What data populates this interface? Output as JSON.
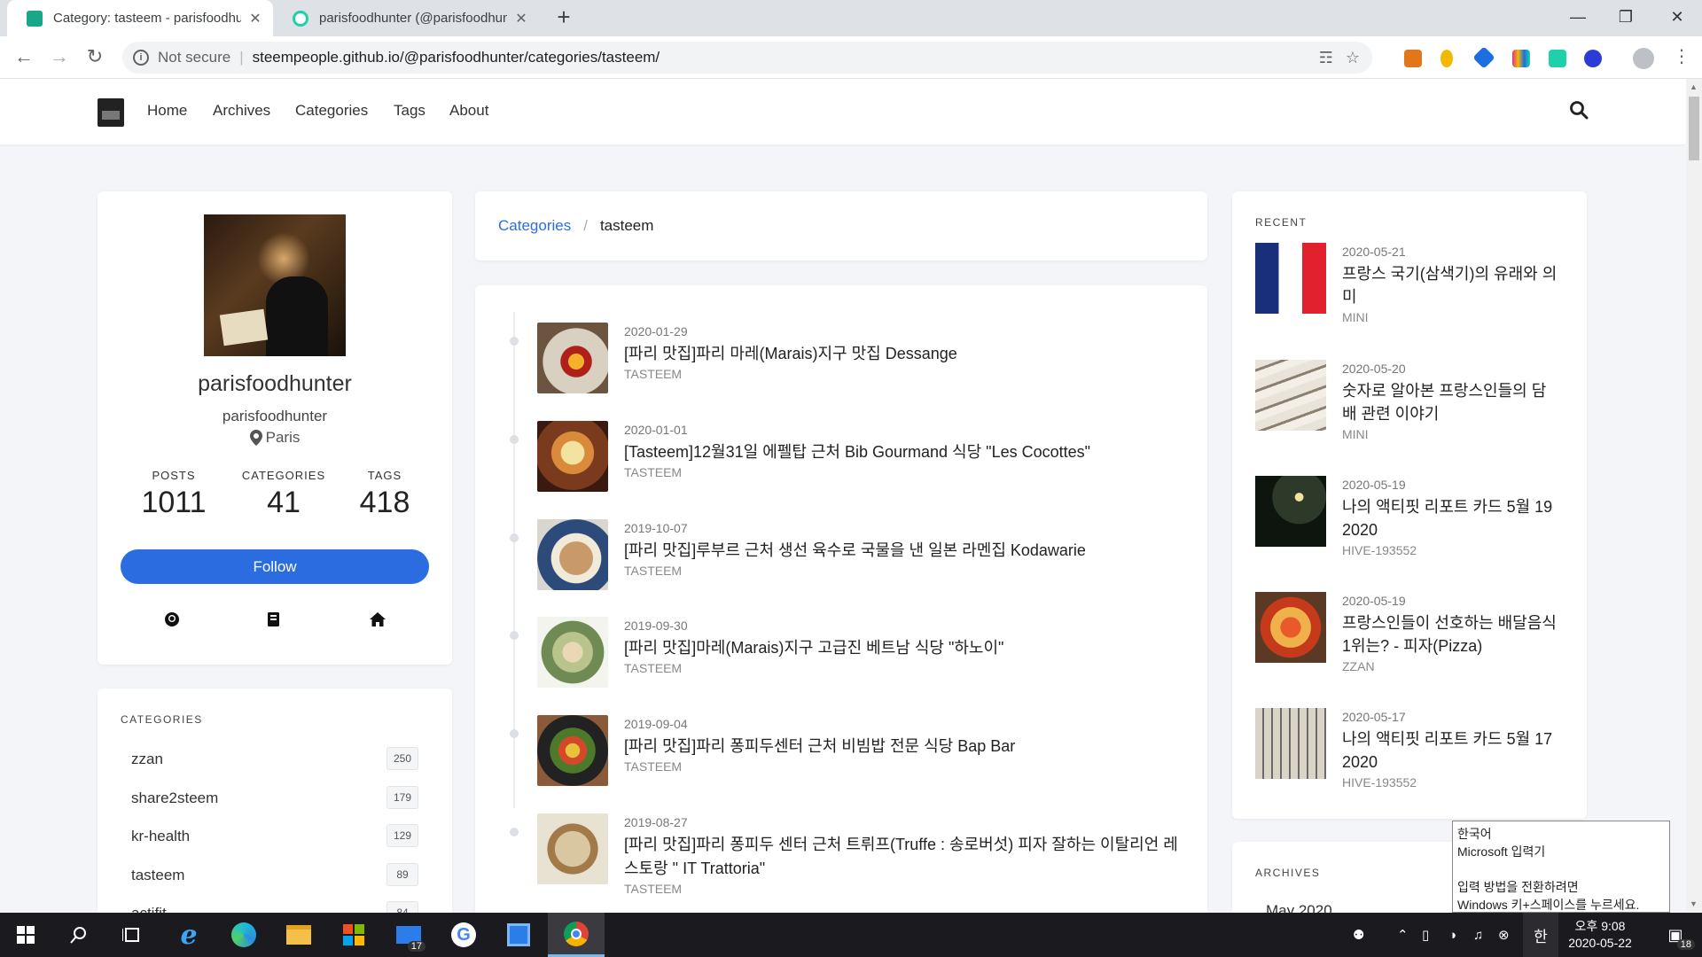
{
  "browser": {
    "tabs": [
      {
        "title": "Category: tasteem - parisfoodhunter",
        "close": "✕"
      },
      {
        "title": "parisfoodhunter (@parisfoodhunter)",
        "close": "✕"
      }
    ],
    "new_tab": "+",
    "window": {
      "minimize": "—",
      "maximize": "❐",
      "close": "✕"
    },
    "address": {
      "security": "Not secure",
      "separator": "|",
      "url": "steempeople.github.io/@parisfoodhunter/categories/tasteem/"
    },
    "icons": [
      "back-icon",
      "forward-icon",
      "reload-icon",
      "translate-icon",
      "star-icon",
      "profile-icon",
      "menu-icon"
    ],
    "extension_colors": [
      "#e2761b",
      "#f5b800",
      "#1d6fe0",
      "#e0348a",
      "#1fd1a8",
      "#2a3bd7"
    ]
  },
  "site": {
    "nav": [
      "Home",
      "Archives",
      "Categories",
      "Tags",
      "About"
    ]
  },
  "profile": {
    "name": "parisfoodhunter",
    "username": "parisfoodhunter",
    "location": "Paris",
    "stats": [
      {
        "label": "POSTS",
        "value": "1011"
      },
      {
        "label": "CATEGORIES",
        "value": "41"
      },
      {
        "label": "TAGS",
        "value": "418"
      }
    ],
    "follow_label": "Follow",
    "social_icons": [
      "github-icon",
      "book-icon",
      "home-icon"
    ]
  },
  "categories_card": {
    "heading": "CATEGORIES",
    "items": [
      {
        "name": "zzan",
        "count": "250"
      },
      {
        "name": "share2steem",
        "count": "179"
      },
      {
        "name": "kr-health",
        "count": "129"
      },
      {
        "name": "tasteem",
        "count": "89"
      },
      {
        "name": "actifit",
        "count": "84"
      }
    ]
  },
  "breadcrumb": {
    "root": "Categories",
    "sep": "/",
    "current": "tasteem"
  },
  "posts": [
    {
      "date": "2020-01-29",
      "title": "[파리 맛집]파리 마레(Marais)지구 맛집 Dessange",
      "category": "TASTEEM"
    },
    {
      "date": "2020-01-01",
      "title": "[Tasteem]12월31일 에펠탑 근처 Bib Gourmand 식당 \"Les Cocottes\"",
      "category": "TASTEEM"
    },
    {
      "date": "2019-10-07",
      "title": "[파리 맛집]루부르 근처 생선 육수로 국물을 낸 일본 라멘집 Kodawarie",
      "category": "TASTEEM"
    },
    {
      "date": "2019-09-30",
      "title": "[파리 맛집]마레(Marais)지구 고급진 베트남 식당 \"하노이\"",
      "category": "TASTEEM"
    },
    {
      "date": "2019-09-04",
      "title": "[파리 맛집]파리 퐁피두센터 근처 비빔밥 전문 식당 Bap Bar",
      "category": "TASTEEM"
    },
    {
      "date": "2019-08-27",
      "title": "[파리 맛집]파리 퐁피두 센터 근처 트뤼프(Truffe : 송로버섯) 피자 잘하는 이탈리언 레스토랑 \" IT Trattoria\"",
      "category": "TASTEEM"
    }
  ],
  "recent": {
    "heading": "RECENT",
    "items": [
      {
        "date": "2020-05-21",
        "title": "프랑스 국기(삼색기)의 유래와 의미",
        "category": "MINI"
      },
      {
        "date": "2020-05-20",
        "title": "숫자로 알아본 프랑스인들의 담배 관련 이야기",
        "category": "MINI"
      },
      {
        "date": "2020-05-19",
        "title": "나의 액티핏 리포트 카드 5월 19 2020",
        "category": "HIVE-193552"
      },
      {
        "date": "2020-05-19",
        "title": "프랑스인들이 선호하는 배달음식 1위는? - 피자(Pizza)",
        "category": "ZZAN"
      },
      {
        "date": "2020-05-17",
        "title": "나의 액티핏 리포트 카드 5월 17 2020",
        "category": "HIVE-193552"
      }
    ]
  },
  "archives": {
    "heading": "ARCHIVES",
    "first": "May 2020"
  },
  "ime_tooltip": {
    "line1": "한국어",
    "line2": "Microsoft 입력기",
    "line3": "입력 방법을 전환하려면",
    "line4": "Windows 키+스페이스를 누르세요."
  },
  "taskbar": {
    "mail_badge": "17",
    "notif_badge": "18",
    "ime": "한",
    "time": "오후 9:08",
    "date": "2020-05-22"
  }
}
